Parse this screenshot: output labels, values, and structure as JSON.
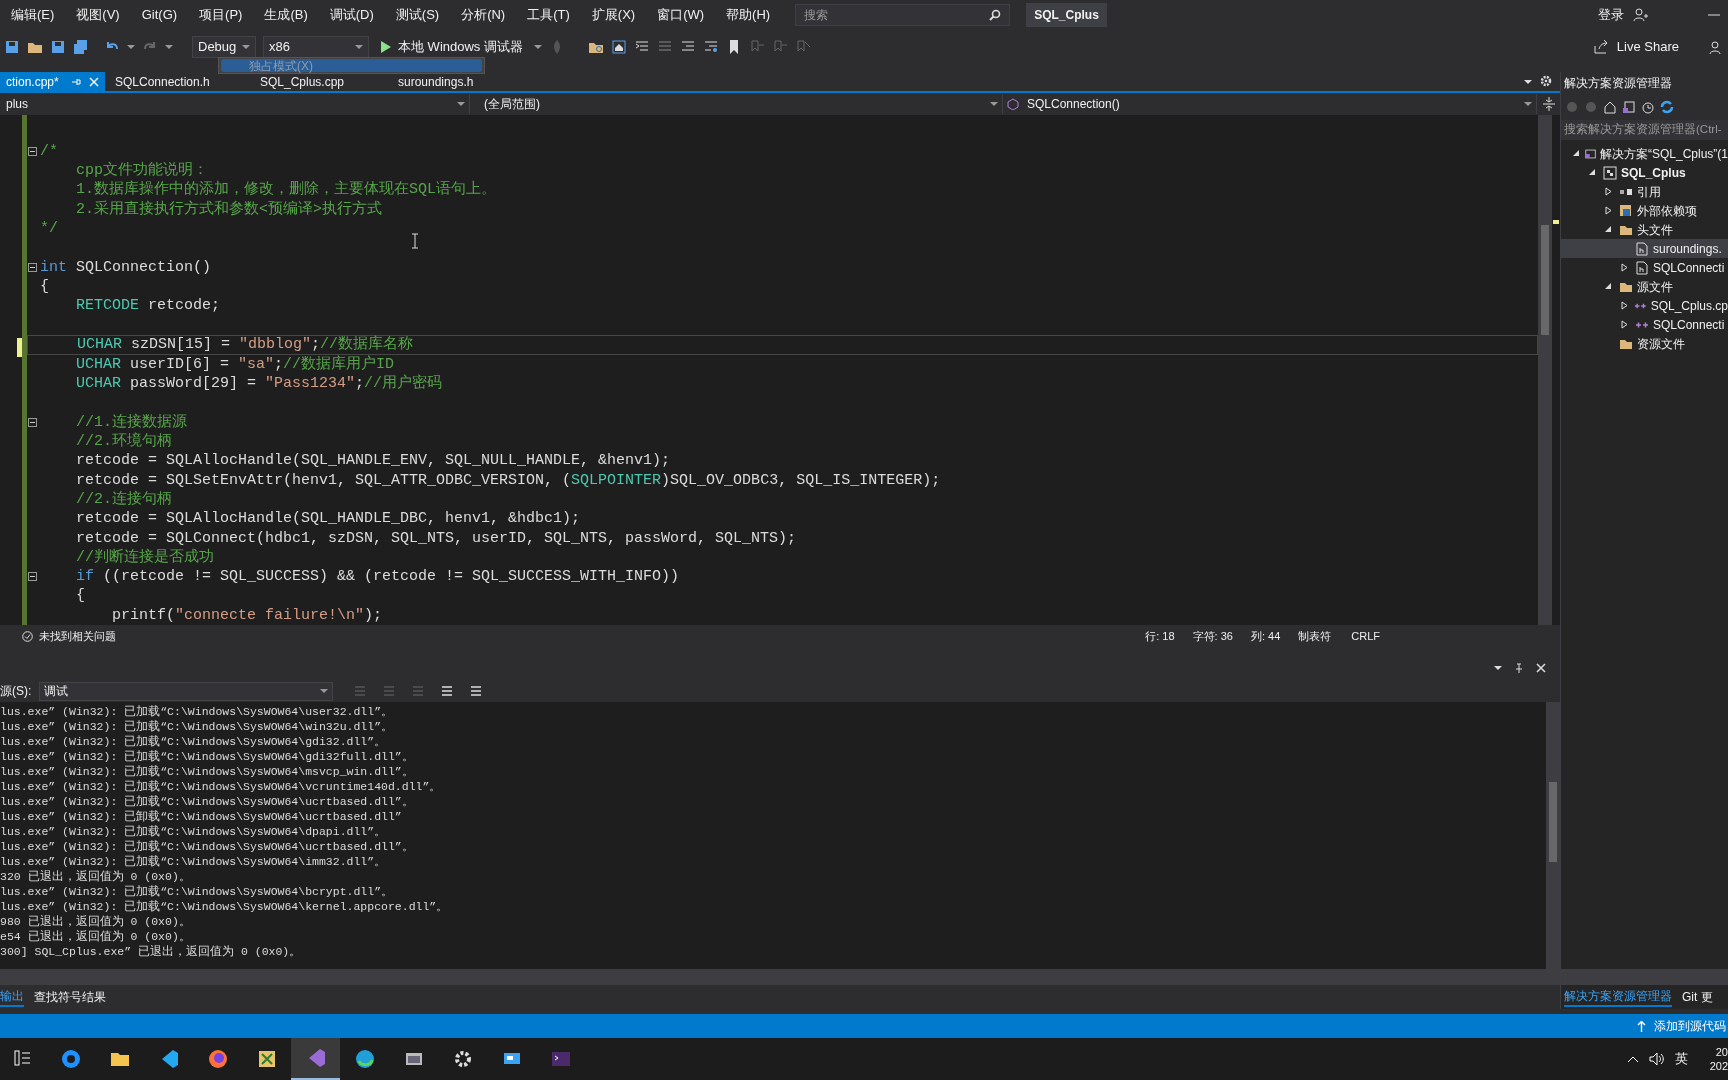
{
  "menu": [
    "编辑(E)",
    "视图(V)",
    "Git(G)",
    "项目(P)",
    "生成(B)",
    "调试(D)",
    "测试(S)",
    "分析(N)",
    "工具(T)",
    "扩展(X)",
    "窗口(W)",
    "帮助(H)"
  ],
  "search": {
    "placeholder": "搜索"
  },
  "solution_title": "SQL_Cplus",
  "login": "登录",
  "toolbar": {
    "configuration": "Debug",
    "platform": "x86",
    "run": "本地 Windows 调试器",
    "live_share": "Live Share"
  },
  "tooltip": "独占模式(X)",
  "tabs": [
    {
      "label": "ction.cpp*",
      "selected": true
    },
    {
      "label": "SQLConnection.h",
      "selected": false
    },
    {
      "label": "SQL_Cplus.cpp",
      "selected": false
    },
    {
      "label": "suroundings.h",
      "selected": false
    }
  ],
  "navigation": {
    "project": "plus",
    "scope": "(全局范围)",
    "member": "SQLConnection()"
  },
  "code": [
    {
      "gap_before": true,
      "foldable": true,
      "current": false,
      "tokens": [
        {
          "kind": "comment",
          "text": "/*"
        }
      ]
    },
    {
      "foldable": false,
      "current": false,
      "tokens": [
        {
          "kind": "comment",
          "text": "    cpp文件功能说明："
        }
      ]
    },
    {
      "foldable": false,
      "current": false,
      "tokens": [
        {
          "kind": "comment",
          "text": "    1.数据库操作中的添加，修改，删除，主要体现在SQL语句上。"
        }
      ]
    },
    {
      "foldable": false,
      "current": false,
      "tokens": [
        {
          "kind": "comment",
          "text": "    2.采用直接执行方式和参数<预编译>执行方式"
        }
      ]
    },
    {
      "foldable": false,
      "current": false,
      "tokens": [
        {
          "kind": "comment",
          "text": "*/"
        }
      ]
    },
    {
      "gap_before": true,
      "foldable": true,
      "current": false,
      "tokens": [
        {
          "kind": "keyword",
          "text": "int"
        },
        {
          "kind": "plain",
          "text": " SQLConnection()"
        }
      ]
    },
    {
      "foldable": false,
      "current": false,
      "tokens": [
        {
          "kind": "plain",
          "text": "{"
        }
      ]
    },
    {
      "foldable": false,
      "current": false,
      "tokens": [
        {
          "kind": "type",
          "text": "    RETCODE"
        },
        {
          "kind": "plain",
          "text": " retcode;"
        }
      ]
    },
    {
      "gap_before": true,
      "foldable": false,
      "current": true,
      "tokens": [
        {
          "kind": "type",
          "text": "    UCHAR"
        },
        {
          "kind": "plain",
          "text": " szDSN[15] = "
        },
        {
          "kind": "string",
          "text": "\"dbblog\""
        },
        {
          "kind": "plain",
          "text": ";"
        },
        {
          "kind": "comment",
          "text": "//数据库名称"
        }
      ]
    },
    {
      "foldable": false,
      "current": false,
      "tokens": [
        {
          "kind": "type",
          "text": "    UCHAR"
        },
        {
          "kind": "plain",
          "text": " userID[6] = "
        },
        {
          "kind": "string",
          "text": "\"sa\""
        },
        {
          "kind": "plain",
          "text": ";"
        },
        {
          "kind": "comment",
          "text": "//数据库用户ID"
        }
      ]
    },
    {
      "foldable": false,
      "current": false,
      "tokens": [
        {
          "kind": "type",
          "text": "    UCHAR"
        },
        {
          "kind": "plain",
          "text": " passWord[29] = "
        },
        {
          "kind": "string",
          "text": "\"Pass1234\""
        },
        {
          "kind": "plain",
          "text": ";"
        },
        {
          "kind": "comment",
          "text": "//用户密码"
        }
      ]
    },
    {
      "gap_before": true,
      "foldable": true,
      "current": false,
      "tokens": [
        {
          "kind": "comment",
          "text": "    //1.连接数据源"
        }
      ]
    },
    {
      "foldable": false,
      "current": false,
      "tokens": [
        {
          "kind": "comment",
          "text": "    //2.环境句柄"
        }
      ]
    },
    {
      "foldable": false,
      "current": false,
      "tokens": [
        {
          "kind": "plain",
          "text": "    retcode = SQLAllocHandle(SQL_HANDLE_ENV, SQL_NULL_HANDLE, &henv1);"
        }
      ]
    },
    {
      "foldable": false,
      "current": false,
      "tokens": [
        {
          "kind": "plain",
          "text": "    retcode = SQLSetEnvAttr(henv1, SQL_ATTR_ODBC_VERSION, ("
        },
        {
          "kind": "type",
          "text": "SQLPOINTER"
        },
        {
          "kind": "plain",
          "text": ")SQL_OV_ODBC3, SQL_IS_INTEGER);"
        }
      ]
    },
    {
      "foldable": false,
      "current": false,
      "tokens": [
        {
          "kind": "comment",
          "text": "    //2.连接句柄"
        }
      ]
    },
    {
      "foldable": false,
      "current": false,
      "tokens": [
        {
          "kind": "plain",
          "text": "    retcode = SQLAllocHandle(SQL_HANDLE_DBC, henv1, &hdbc1);"
        }
      ]
    },
    {
      "foldable": false,
      "current": false,
      "tokens": [
        {
          "kind": "plain",
          "text": "    retcode = SQLConnect(hdbc1, szDSN, SQL_NTS, userID, SQL_NTS, passWord, SQL_NTS);"
        }
      ]
    },
    {
      "foldable": false,
      "current": false,
      "tokens": [
        {
          "kind": "comment",
          "text": "    //判断连接是否成功"
        }
      ]
    },
    {
      "foldable": true,
      "current": false,
      "tokens": [
        {
          "kind": "keyword",
          "text": "    if"
        },
        {
          "kind": "plain",
          "text": " ((retcode != SQL_SUCCESS) && (retcode != SQL_SUCCESS_WITH_INFO))"
        }
      ]
    },
    {
      "foldable": false,
      "current": false,
      "tokens": [
        {
          "kind": "plain",
          "text": "    {"
        }
      ]
    },
    {
      "foldable": false,
      "current": false,
      "tokens": [
        {
          "kind": "plain",
          "text": "        printf("
        },
        {
          "kind": "string",
          "text": "\"connecte failure!\\n\""
        },
        {
          "kind": "plain",
          "text": ");"
        }
      ]
    }
  ],
  "editor_status": {
    "issues": "未找到相关问题",
    "line": "行: 18",
    "char": "字符: 36",
    "column": "列: 44",
    "indent": "制表符",
    "eol": "CRLF"
  },
  "output": {
    "source_label": "源(S):",
    "source": "调试",
    "lines": [
      "lus.exe” (Win32): 已加载“C:\\Windows\\SysWOW64\\user32.dll”。",
      "lus.exe” (Win32): 已加载“C:\\Windows\\SysWOW64\\win32u.dll”。",
      "lus.exe” (Win32): 已加载“C:\\Windows\\SysWOW64\\gdi32.dll”。",
      "lus.exe” (Win32): 已加载“C:\\Windows\\SysWOW64\\gdi32full.dll”。",
      "lus.exe” (Win32): 已加载“C:\\Windows\\SysWOW64\\msvcp_win.dll”。",
      "lus.exe” (Win32): 已加载“C:\\Windows\\SysWOW64\\vcruntime140d.dll”。",
      "lus.exe” (Win32): 已加载“C:\\Windows\\SysWOW64\\ucrtbased.dll”。",
      "lus.exe” (Win32): 已卸载“C:\\Windows\\SysWOW64\\ucrtbased.dll”",
      "lus.exe” (Win32): 已加载“C:\\Windows\\SysWOW64\\dpapi.dll”。",
      "lus.exe” (Win32): 已加载“C:\\Windows\\SysWOW64\\ucrtbased.dll”。",
      "lus.exe” (Win32): 已加载“C:\\Windows\\SysWOW64\\imm32.dll”。",
      "320 已退出，返回值为 0 (0x0)。",
      "lus.exe” (Win32): 已加载“C:\\Windows\\SysWOW64\\bcrypt.dll”。",
      "lus.exe” (Win32): 已加载“C:\\Windows\\SysWOW64\\kernel.appcore.dll”。",
      "980 已退出，返回值为 0 (0x0)。",
      "e54 已退出，返回值为 0 (0x0)。",
      "300] SQL_Cplus.exe” 已退出，返回值为 0 (0x0)。"
    ]
  },
  "bottom_tabs": [
    {
      "label": "输出",
      "selected": true
    },
    {
      "label": "查找符号结果",
      "selected": false
    }
  ],
  "solution_explorer": {
    "title": "解决方案资源管理器",
    "search_placeholder": "搜索解决方案资源管理器(Ctrl-",
    "tree": [
      {
        "label": "解决方案“SQL_Cplus”(1",
        "kind": "solution",
        "expanded": true,
        "selected": false,
        "children": [
          {
            "label": "SQL_Cplus",
            "kind": "project",
            "expanded": true,
            "selected": false,
            "children": [
              {
                "label": "引用",
                "kind": "refs",
                "expanded": false,
                "selected": false
              },
              {
                "label": "外部依赖项",
                "kind": "deps",
                "expanded": false,
                "selected": false
              },
              {
                "label": "头文件",
                "kind": "folder",
                "expanded": true,
                "selected": false,
                "children": [
                  {
                    "label": "suroundings.",
                    "kind": "header",
                    "selected": true
                  },
                  {
                    "label": "SQLConnecti",
                    "kind": "header",
                    "expanded": false,
                    "selected": false
                  }
                ]
              },
              {
                "label": "源文件",
                "kind": "folder",
                "expanded": true,
                "selected": false,
                "children": [
                  {
                    "label": "SQL_Cplus.cp",
                    "kind": "source",
                    "expanded": false,
                    "selected": false
                  },
                  {
                    "label": "SQLConnecti",
                    "kind": "source",
                    "expanded": false,
                    "selected": false
                  }
                ]
              },
              {
                "label": "资源文件",
                "kind": "folder",
                "selected": false
              }
            ]
          }
        ]
      }
    ],
    "tabs": [
      {
        "label": "解决方案资源管理器",
        "selected": true
      },
      {
        "label": "Git 更",
        "selected": false
      }
    ]
  },
  "status_bar": {
    "source_control": "添加到源代码"
  },
  "taskbar": {
    "input_method": "英",
    "clock": [
      "20",
      "202"
    ]
  }
}
